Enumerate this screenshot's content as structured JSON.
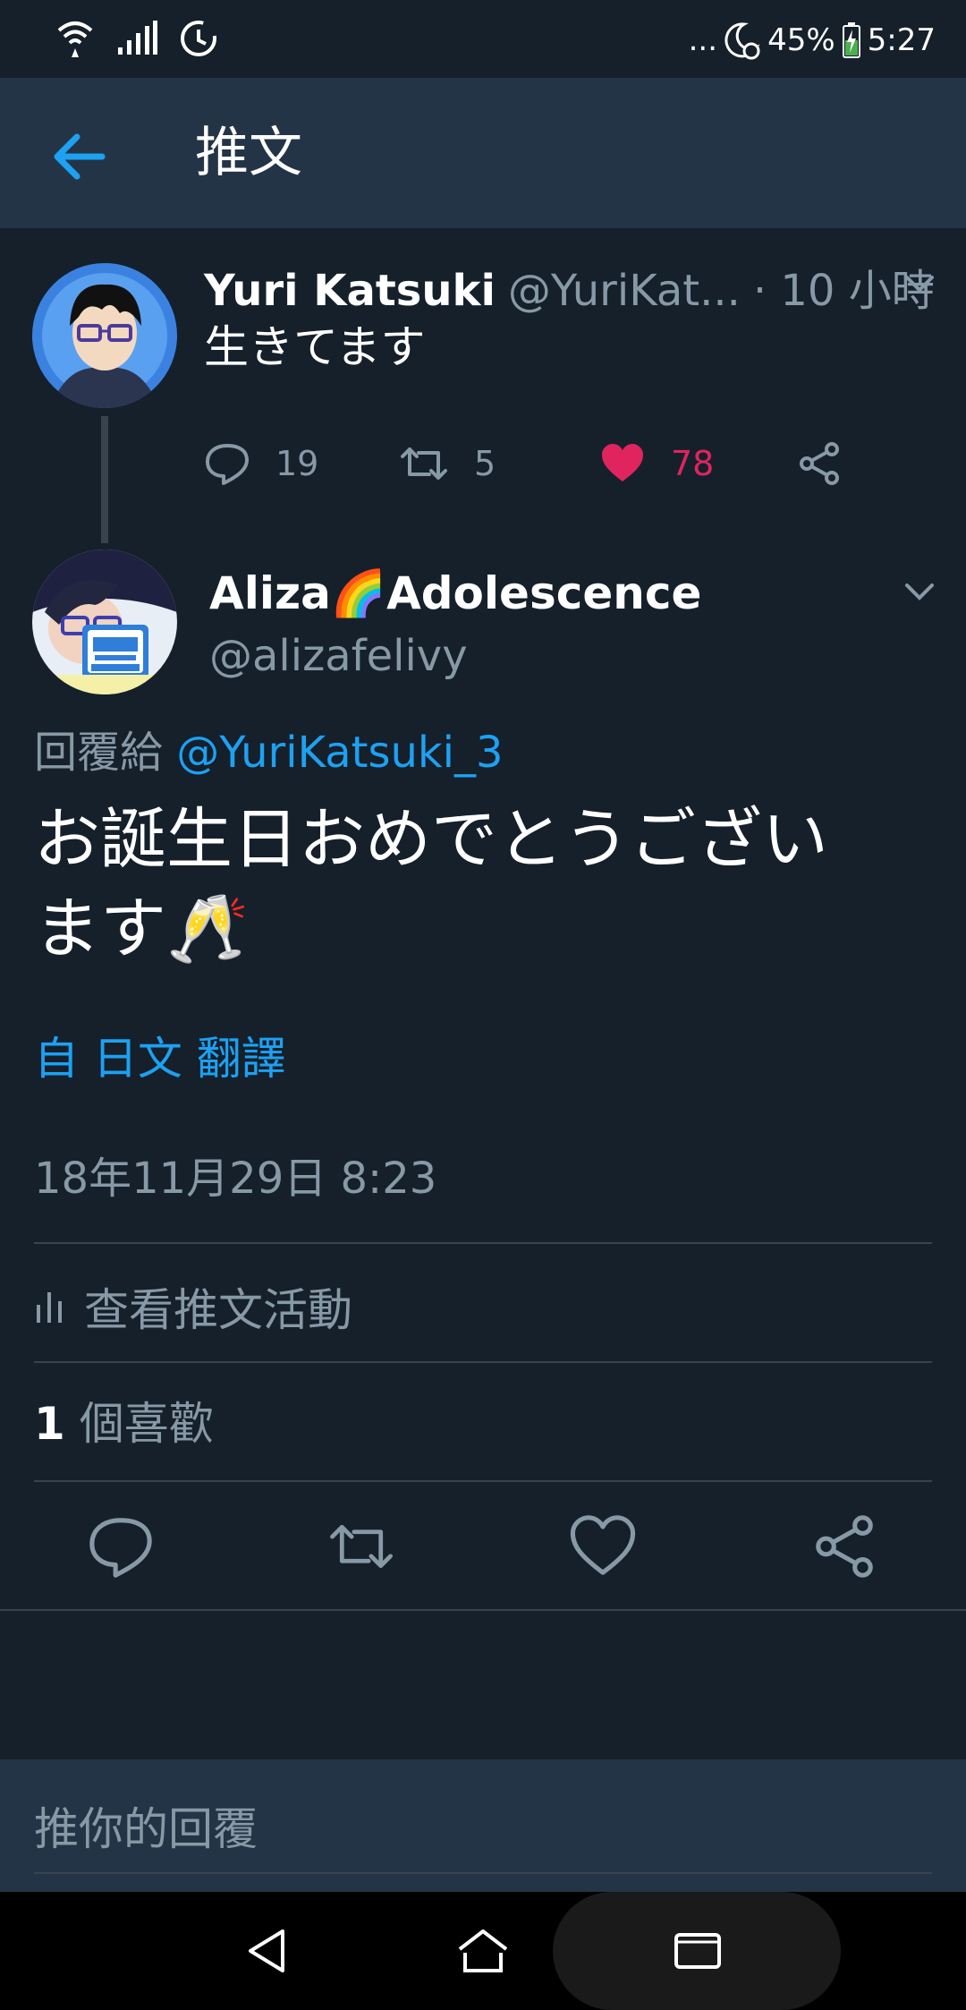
{
  "status_bar": {
    "dots": "...",
    "battery_percent": "45%",
    "time": "5:27",
    "icons": [
      "wifi-icon",
      "signal-icon",
      "sync-icon",
      "do-not-disturb-icon",
      "battery-charging-icon"
    ]
  },
  "header": {
    "title": "推文",
    "back_icon": "arrow-left-icon"
  },
  "parent_tweet": {
    "name": "Yuri Katsuki",
    "handle": "@YuriKat...",
    "time": "· 10 小時",
    "text": "生きてます",
    "reply_count": "19",
    "retweet_count": "5",
    "like_count": "78",
    "liked": true
  },
  "tweet": {
    "name": "Aliza🌈Adolescence",
    "handle": "@alizafelivy",
    "reply_prefix": "回覆給",
    "reply_mention": "@YuriKatsuki_3",
    "text": "お誕生日おめでとうございます🥂",
    "translate_label": "自 日文 翻譯",
    "timestamp": "18年11月29日 8:23",
    "activity_label": "查看推文活動",
    "likes_number": "1",
    "likes_label": "個喜歡"
  },
  "reply_bar": {
    "placeholder": "推你的回覆"
  },
  "colors": {
    "background": "#15202b",
    "header": "#243447",
    "accent": "#1da1f2",
    "like": "#e0245e",
    "secondary_text": "#8899a6",
    "divider": "#38444d"
  }
}
